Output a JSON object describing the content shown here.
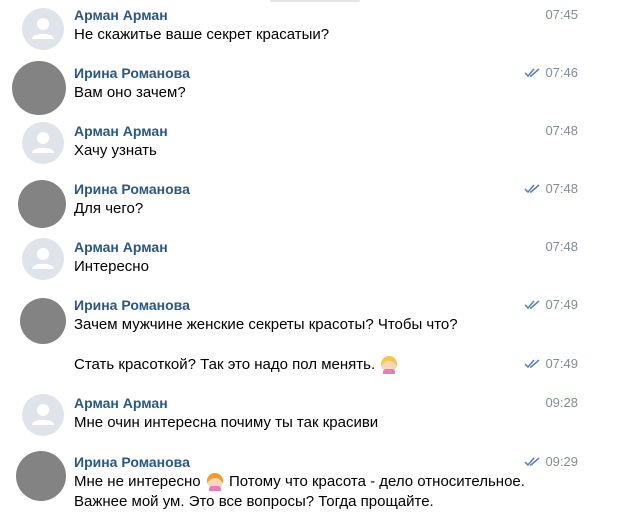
{
  "messages": [
    {
      "author": "Арман Арман",
      "time": "07:45",
      "read": false,
      "avatar": "default-user-icon",
      "lines": [
        "Не скажитье ваше секрет красатыи?"
      ]
    },
    {
      "author": "Ирина Романова",
      "time": "07:46",
      "read": true,
      "avatar": "blurred-photo",
      "lines": [
        "Вам оно зачем?"
      ]
    },
    {
      "author": "Арман Арман",
      "time": "07:48",
      "read": false,
      "avatar": "default-user-icon",
      "lines": [
        "Хачу узнать"
      ]
    },
    {
      "author": "Ирина Романова",
      "time": "07:48",
      "read": true,
      "avatar": "blurred-photo",
      "lines": [
        "Для чего?"
      ]
    },
    {
      "author": "Арман Арман",
      "time": "07:48",
      "read": false,
      "avatar": "default-user-icon",
      "lines": [
        "Интересно"
      ]
    },
    {
      "author": "Ирина Романова",
      "time": "07:49",
      "read": true,
      "avatar": "blurred-photo",
      "lines": [
        "Зачем мужчине женские секреты красоты? Чтобы что?"
      ]
    },
    {
      "continuation": true,
      "time": "07:49",
      "read": true,
      "lines": [
        "Стать красоткой? Так это надо пол менять."
      ],
      "emoji": "woman-gesturing-no-emoji"
    },
    {
      "author": "Арман Арман",
      "time": "09:28",
      "read": false,
      "avatar": "default-user-icon",
      "lines": [
        "Мне очин интересна почиму ты так красиви"
      ]
    },
    {
      "author": "Ирина Романова",
      "time": "09:29",
      "read": true,
      "avatar": "blurred-photo",
      "lines": [
        "Мне не интересно",
        "Потому что красота - дело относительное.",
        "Важнее мой ум. Это все вопросы? Тогда прощайте."
      ],
      "emoji": "woman-gesturing-no-emoji"
    }
  ],
  "colors": {
    "author": "#2a5885",
    "time": "#818c99",
    "check": "#5181b8",
    "text": "#000000"
  }
}
